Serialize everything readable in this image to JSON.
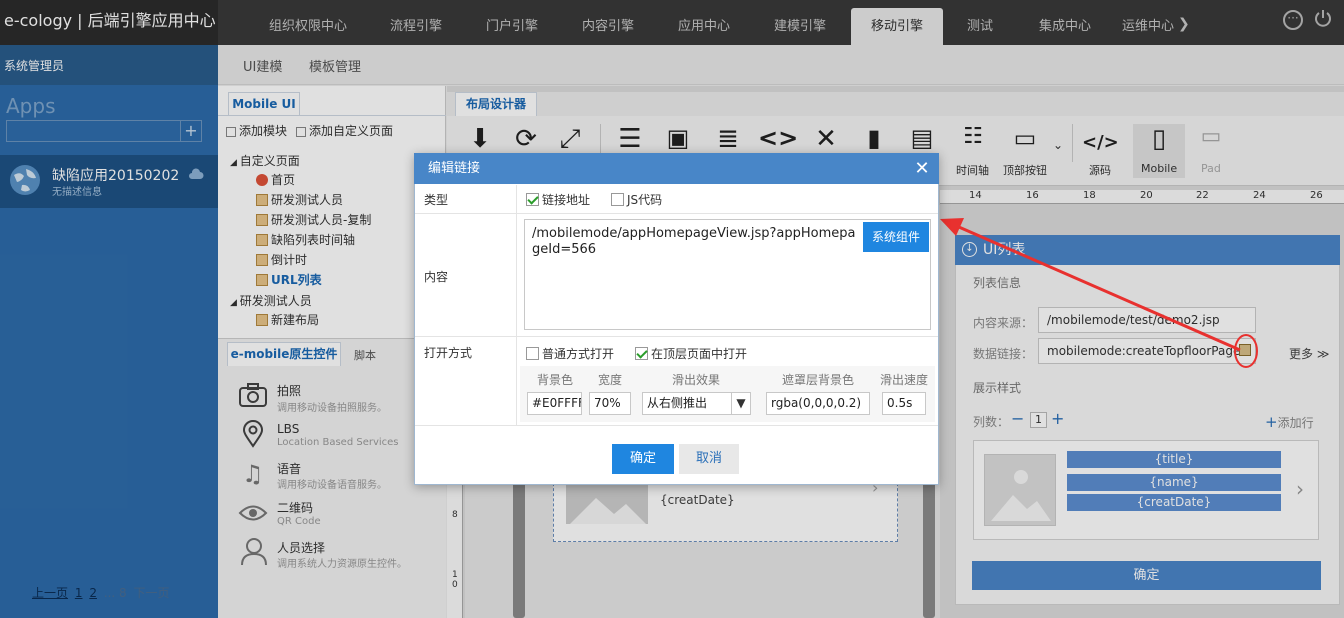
{
  "header": {
    "brand": "e-cology | 后端引擎应用中心",
    "tabs": [
      "组织权限中心",
      "流程引擎",
      "门户引擎",
      "内容引擎",
      "应用中心",
      "建模引擎",
      "移动引擎",
      "测试",
      "集成中心",
      "运维中心"
    ],
    "active_tab": "移动引擎"
  },
  "left": {
    "admin": "系统管理员",
    "apps_label": "Apps",
    "add": "+",
    "app": {
      "name": "缺陷应用20150202",
      "desc": "无描述信息"
    },
    "pager": {
      "prev": "上一页",
      "p1": "1",
      "p2": "2",
      "dots": "... 8",
      "next": "下一页"
    }
  },
  "subtabs": [
    "UI建模",
    "模板管理"
  ],
  "tree": {
    "tab": "Mobile UI",
    "add_module": "添加模块",
    "add_custom": "添加自定义页面",
    "group1": "自定义页面",
    "items1": [
      "首页",
      "研发测试人员",
      "研发测试人员-复制",
      "缺陷列表时间轴",
      "倒计时",
      "URL列表"
    ],
    "group2": "研发测试人员",
    "items2": [
      "新建布局"
    ]
  },
  "controls": {
    "tab": "e-mobile原生控件",
    "tab2": "脚本",
    "items": [
      {
        "title": "拍照",
        "sub": "调用移动设备拍照服务。"
      },
      {
        "title": "LBS",
        "sub": "Location Based Services"
      },
      {
        "title": "语音",
        "sub": "调用移动设备语音服务。"
      },
      {
        "title": "二维码",
        "sub": "QR Code"
      },
      {
        "title": "人员选择",
        "sub": "调用系统人力资源原生控件。"
      }
    ]
  },
  "designer": {
    "tab": "布局设计器",
    "tools": {
      "timeline": "时间轴",
      "topbtn": "顶部按钮",
      "source": "源码",
      "mobile": "Mobile",
      "pad": "Pad"
    },
    "ruler": [
      "14",
      "16",
      "18",
      "20",
      "22",
      "24",
      "26"
    ],
    "vruler": [
      "8",
      "1",
      "0"
    ],
    "placeholder": "{creatDate}"
  },
  "rightpanel": {
    "title": "UI列表",
    "section_list": "列表信息",
    "source_label": "内容来源：",
    "source_value": "/mobilemode/test/demo2.jsp",
    "link_label": "数据链接：",
    "link_value": "mobilemode:createTopfloorPage",
    "more": "更多",
    "section_style": "展示样式",
    "cols_label": "列数：",
    "cols_value": "1",
    "add_row": "添加行",
    "tags": [
      "{title}",
      "{name}",
      "{creatDate}"
    ],
    "confirm": "确定"
  },
  "dialog": {
    "title": "编辑链接",
    "type_label": "类型",
    "opt_link": "链接地址",
    "opt_js": "JS代码",
    "content_label": "内容",
    "content": "/mobilemode/appHomepageView.jsp?appHomepageId=566",
    "sys_btn": "系统组件",
    "open_label": "打开方式",
    "open_normal": "普通方式打开",
    "open_top": "在顶层页面中打开",
    "cols": [
      "背景色",
      "宽度",
      "滑出效果",
      "遮罩层背景色",
      "滑出速度"
    ],
    "values": {
      "bg": "#E0FFFF",
      "width": "70%",
      "effect": "从右侧推出",
      "mask": "rgba(0,0,0,0.2)",
      "speed": "0.5s"
    },
    "ok": "确定",
    "cancel": "取消"
  },
  "colors": {
    "accent": "#1f86e0",
    "dialog_header": "#4886c8",
    "sidebar": "#2d6cab",
    "annotation": "#e8312f"
  }
}
